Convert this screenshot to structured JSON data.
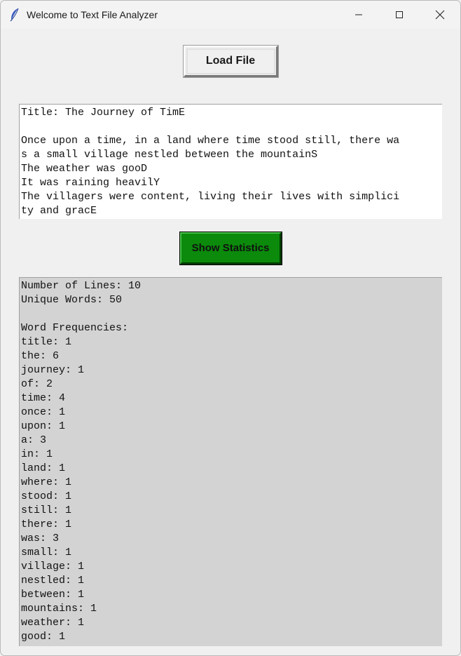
{
  "window": {
    "title": "Welcome to Text File Analyzer",
    "icon": "feather-icon"
  },
  "controls": {
    "load_label": "Load File",
    "stats_label": "Show Statistics",
    "stats_button_color": "#0b8a0b"
  },
  "file_text": {
    "lines": [
      "Title: The Journey of TimE",
      "",
      "Once upon a time, in a land where time stood still, there wa",
      "s a small village nestled between the mountainS",
      "The weather was gooD",
      "It was raining heavilY",
      "The villagers were content, living their lives with simplici",
      "ty and gracE"
    ]
  },
  "stats": {
    "lines": [
      "Number of Lines: 10",
      "Unique Words: 50",
      "",
      "Word Frequencies:",
      "title: 1",
      "the: 6",
      "journey: 1",
      "of: 2",
      "time: 4",
      "once: 1",
      "upon: 1",
      "a: 3",
      "in: 1",
      "land: 1",
      "where: 1",
      "stood: 1",
      "still: 1",
      "there: 1",
      "was: 3",
      "small: 1",
      "village: 1",
      "nestled: 1",
      "between: 1",
      "mountains: 1",
      "weather: 1",
      "good: 1"
    ]
  }
}
